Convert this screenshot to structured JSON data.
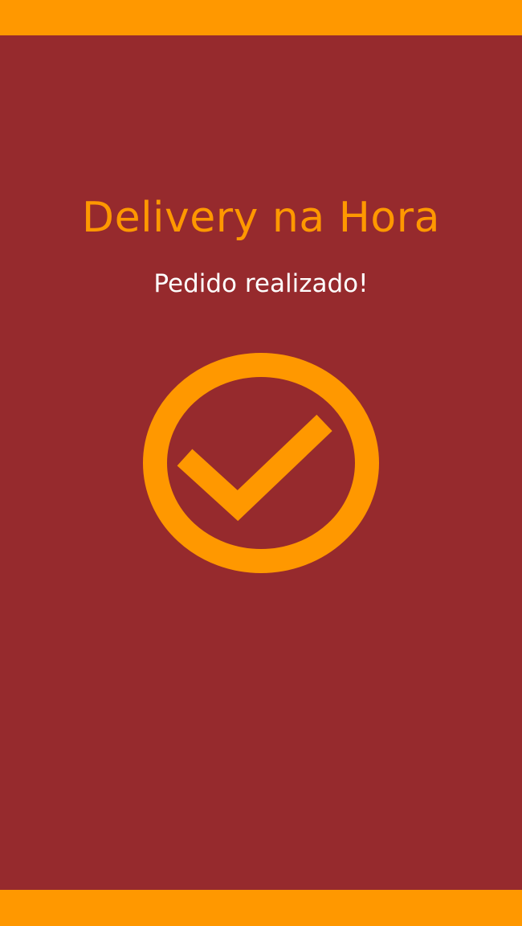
{
  "app": {
    "title": "Delivery na Hora"
  },
  "status": {
    "message": "Pedido realizado!",
    "icon": "check-circle-icon"
  },
  "colors": {
    "background": "#962a2d",
    "accent": "#ff9800",
    "text": "#ffffff"
  }
}
